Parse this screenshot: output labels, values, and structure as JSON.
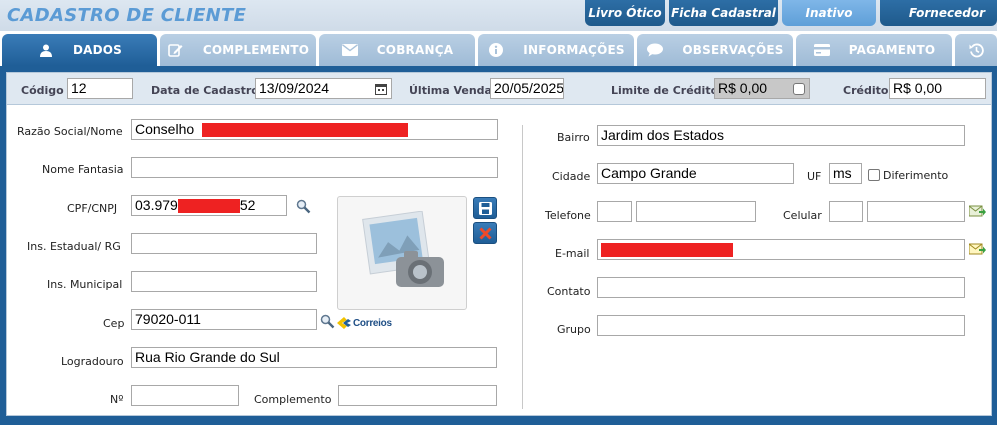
{
  "header": {
    "title": "CADASTRO DE CLIENTE",
    "buttons": [
      "Livro Ótico",
      "Ficha Cadastral",
      "Inativo",
      "Fornecedor"
    ]
  },
  "tabs": [
    "DADOS",
    "COMPLEMENTO",
    "COBRANÇA",
    "INFORMAÇÕES",
    "OBSERVAÇÕES",
    "PAGAMENTO"
  ],
  "topbar": {
    "codigo_label": "Código",
    "codigo": "12",
    "data_cadastro_label": "Data de Cadastro",
    "data_cadastro": "13/09/2024",
    "ultima_venda_label": "Última Venda",
    "ultima_venda": "20/05/2025",
    "limite_label": "Limite de Crédito",
    "limite": "R$ 0,00",
    "credito_label": "Crédito",
    "credito": "R$ 0,00"
  },
  "left": {
    "razao_label": "Razão Social/Nome",
    "razao": "Conselho",
    "fantasia_label": "Nome Fantasia",
    "fantasia": "",
    "cpf_label": "CPF/CNPJ",
    "cpf_start": "03.979",
    "cpf_end": "52",
    "ie_label": "Ins. Estadual/ RG",
    "ie": "",
    "im_label": "Ins. Municipal",
    "im": "",
    "cep_label": "Cep",
    "cep": "79020-011",
    "correios": "Correios",
    "logradouro_label": "Logradouro",
    "logradouro": "Rua Rio Grande do Sul",
    "numero_label": "Nº",
    "numero": "",
    "complemento_label": "Complemento",
    "complemento": ""
  },
  "right": {
    "bairro_label": "Bairro",
    "bairro": "Jardim dos Estados",
    "cidade_label": "Cidade",
    "cidade": "Campo Grande",
    "uf_label": "UF",
    "uf": "ms",
    "diferimento_label": "Diferimento",
    "telefone_label": "Telefone",
    "celular_label": "Celular",
    "email_label": "E-mail",
    "contato_label": "Contato",
    "grupo_label": "Grupo"
  },
  "icons": {
    "user": "user-icon",
    "edit": "edit-icon",
    "mail": "envelope-icon",
    "info": "info-icon",
    "chat": "chat-icon",
    "card": "card-icon",
    "history": "history-icon",
    "calendar": "calendar-icon",
    "search": "search-icon",
    "save": "save-icon",
    "delete": "delete-icon",
    "send": "send-mail-icon",
    "camera": "camera-placeholder-icon"
  },
  "colors": {
    "dark_blue": "#1f5e97",
    "light_blue": "#5e9fd8",
    "tab_inactive": "#a9c2da",
    "redaction": "#ee2222"
  }
}
